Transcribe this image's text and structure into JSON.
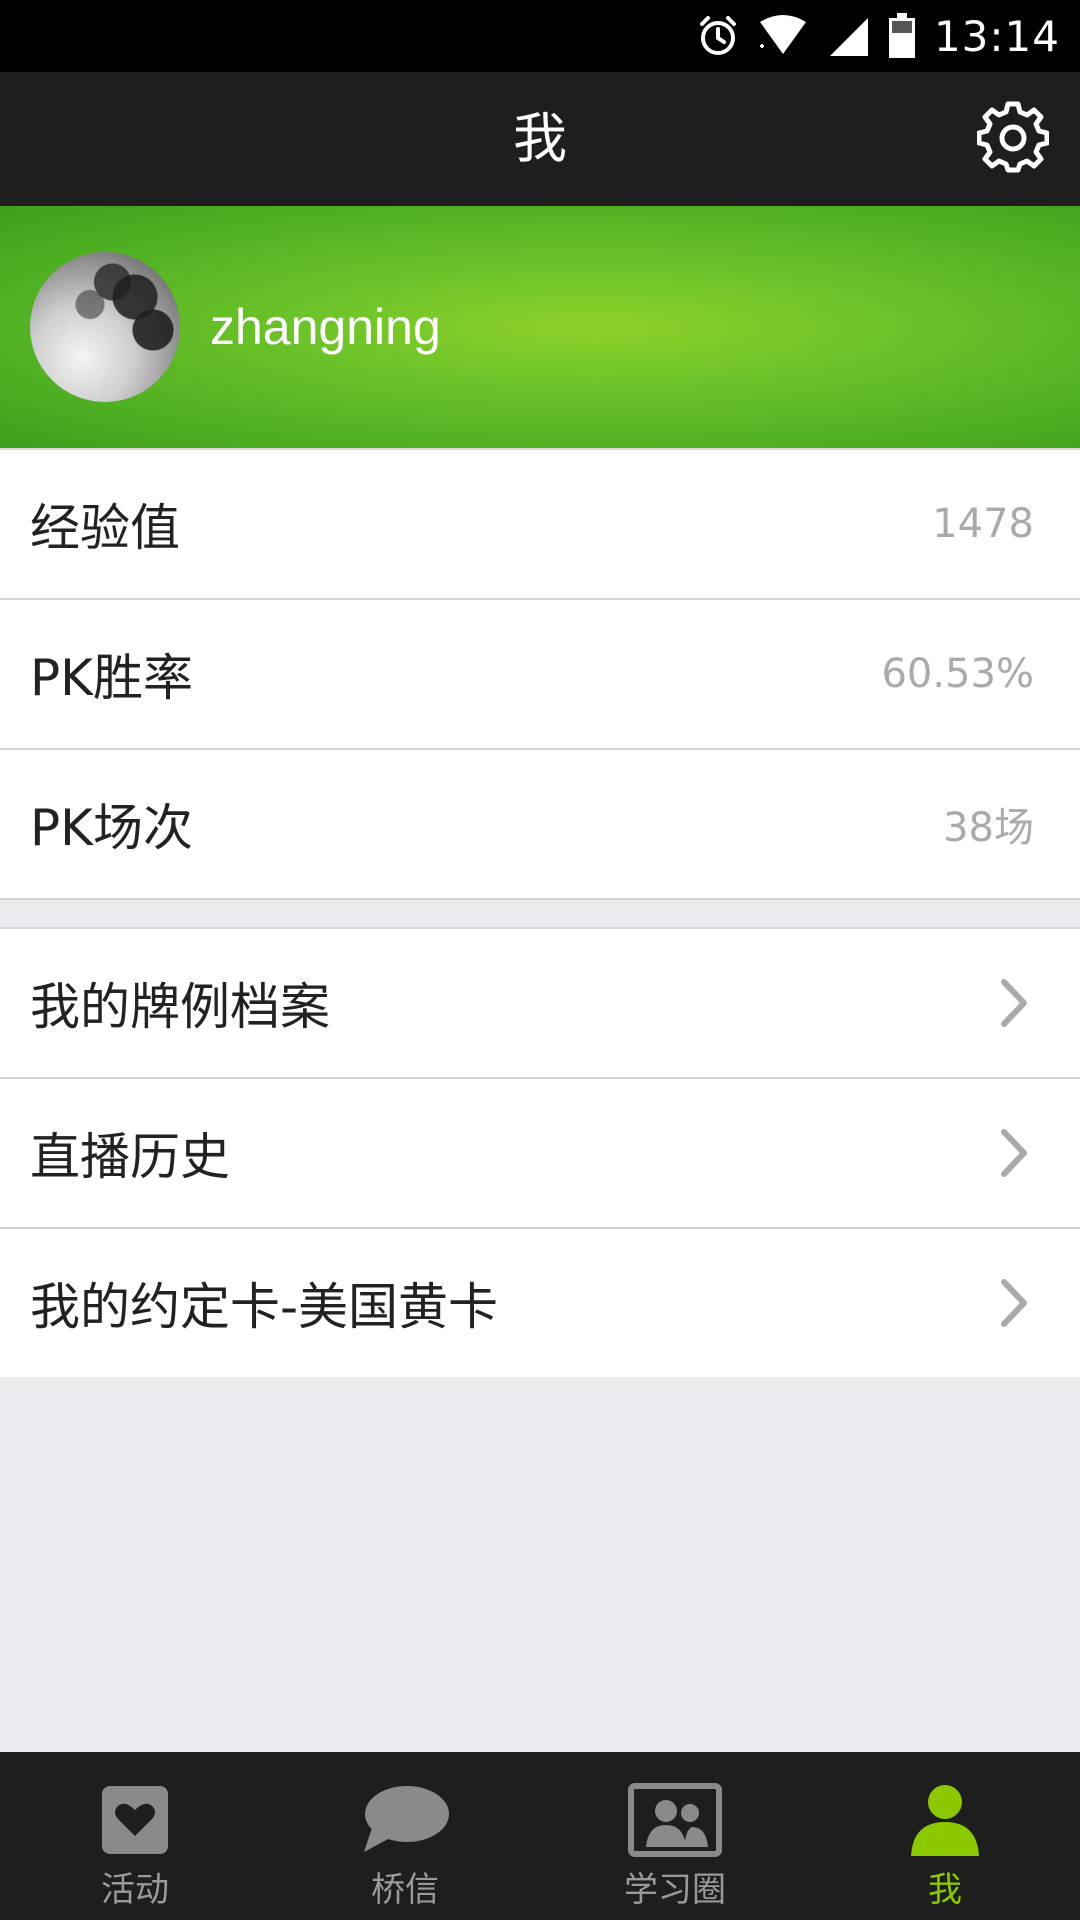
{
  "status_bar": {
    "time": "13:14",
    "icons": [
      "alarm-icon",
      "wifi-icon",
      "signal-icon",
      "battery-icon"
    ]
  },
  "header": {
    "title": "我",
    "settings_icon": "gear-icon"
  },
  "profile": {
    "username": "zhangning",
    "banner_color": "#6cc32a"
  },
  "stats": [
    {
      "label": "经验值",
      "value": "1478"
    },
    {
      "label": "PK胜率",
      "value": "60.53%"
    },
    {
      "label": "PK场次",
      "value": "38场"
    }
  ],
  "menu": [
    {
      "label": "我的牌例档案"
    },
    {
      "label": "直播历史"
    },
    {
      "label": "我的约定卡-美国黄卡"
    }
  ],
  "tabbar": {
    "active_color": "#8cc800",
    "inactive_color": "#9a9a9a",
    "tabs": [
      {
        "label": "活动",
        "icon": "heart-card-icon"
      },
      {
        "label": "桥信",
        "icon": "chat-bubble-icon"
      },
      {
        "label": "学习圈",
        "icon": "group-photo-icon"
      },
      {
        "label": "我",
        "icon": "person-icon",
        "active": true
      }
    ]
  }
}
